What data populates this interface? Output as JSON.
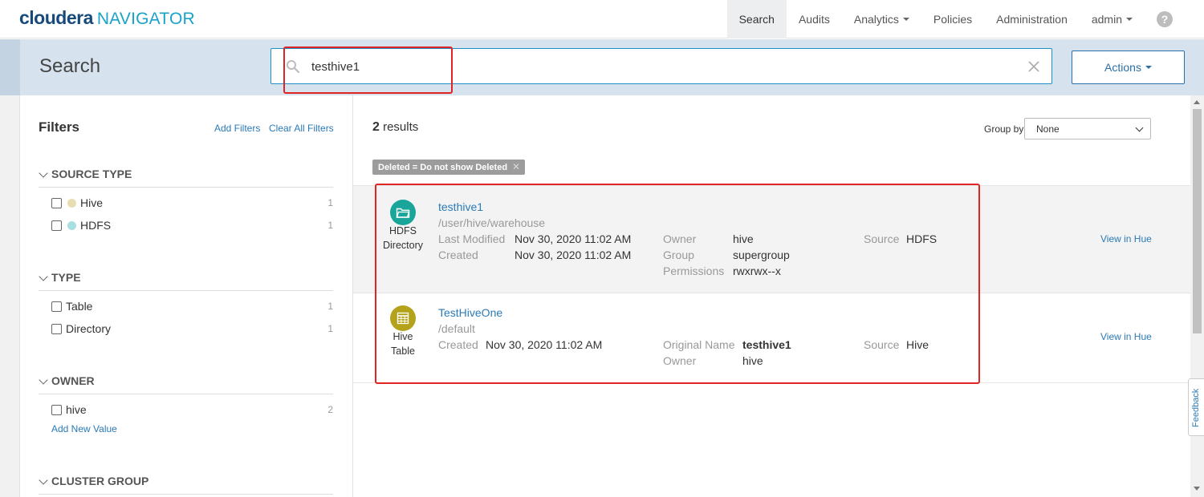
{
  "brand": {
    "name": "cloudera",
    "product": "NAVIGATOR"
  },
  "nav": {
    "items": [
      {
        "label": "Search",
        "active": true
      },
      {
        "label": "Audits"
      },
      {
        "label": "Analytics"
      },
      {
        "label": "Policies"
      },
      {
        "label": "Administration"
      },
      {
        "label": "admin"
      }
    ],
    "help": "?"
  },
  "search": {
    "title": "Search",
    "query": "testhive1",
    "actions_label": "Actions"
  },
  "filters": {
    "title": "Filters",
    "add_filters": "Add Filters",
    "clear_all": "Clear All Filters",
    "sections": [
      {
        "title": "SOURCE TYPE",
        "items": [
          {
            "label": "Hive",
            "count": "1",
            "dot_color": "#e6deb0"
          },
          {
            "label": "HDFS",
            "count": "1",
            "dot_color": "#a8dfe0"
          }
        ]
      },
      {
        "title": "TYPE",
        "items": [
          {
            "label": "Table",
            "count": "1"
          },
          {
            "label": "Directory",
            "count": "1"
          }
        ]
      },
      {
        "title": "OWNER",
        "items": [
          {
            "label": "hive",
            "count": "2"
          }
        ],
        "add_value": "Add New Value"
      },
      {
        "title": "CLUSTER GROUP",
        "items": []
      }
    ]
  },
  "results": {
    "count": "2",
    "count_suffix": "results",
    "group_by_label": "Group by",
    "group_by_value": "None",
    "chip": "Deleted = Do not show Deleted",
    "chip_close": "✕",
    "items": [
      {
        "type_line1": "HDFS",
        "type_line2": "Directory",
        "icon": "folder-icon",
        "icon_color": "#1aa59a",
        "title": "testhive1",
        "path": "/user/hive/warehouse",
        "last_modified_label": "Last Modified",
        "last_modified": "Nov 30, 2020 11:02 AM",
        "created_label": "Created",
        "created": "Nov 30, 2020 11:02 AM",
        "owner_label": "Owner",
        "owner": "hive",
        "group_label": "Group",
        "group": "supergroup",
        "permissions_label": "Permissions",
        "permissions": "rwxrwx--x",
        "source_label": "Source",
        "source": "HDFS",
        "view_link": "View in Hue"
      },
      {
        "type_line1": "Hive",
        "type_line2": "Table",
        "icon": "table-icon",
        "icon_color": "#b5a21b",
        "title": "TestHiveOne",
        "path": "/default",
        "created_label": "Created",
        "created": "Nov 30, 2020 11:02 AM",
        "original_name_label": "Original Name",
        "original_name": "testhive1",
        "owner_label": "Owner",
        "owner": "hive",
        "source_label": "Source",
        "source": "Hive",
        "view_link": "View in Hue"
      }
    ]
  },
  "feedback": "Feedback"
}
